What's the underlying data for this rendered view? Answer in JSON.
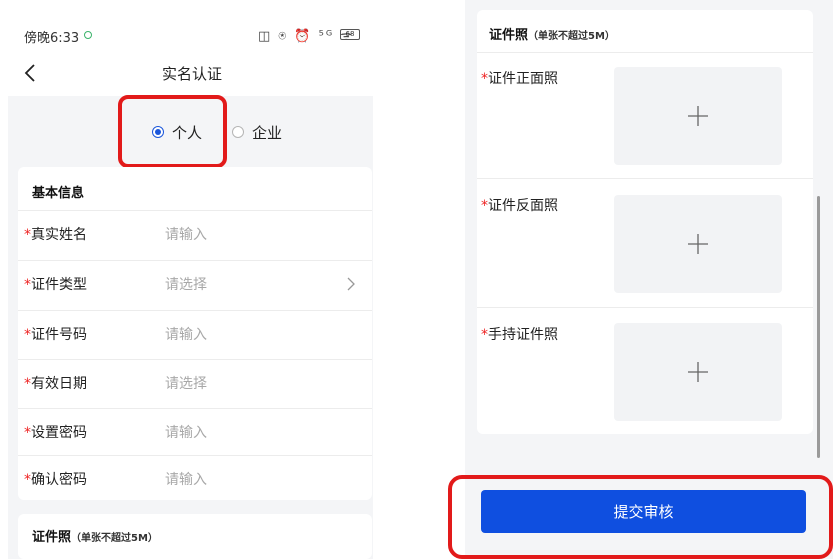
{
  "status_bar": {
    "time": "傍晚6:33",
    "icons_text": "◫ ⍟ ⏰ ⁵ᴳ ᯤ",
    "battery": "68"
  },
  "nav": {
    "title": "实名认证",
    "back_icon": "chevron-left-icon"
  },
  "identity_type": {
    "options": [
      {
        "label": "个人",
        "selected": true
      },
      {
        "label": "企业",
        "selected": false
      }
    ]
  },
  "basic_info": {
    "title": "基本信息",
    "required_mark": "*",
    "fields": [
      {
        "label": "真实姓名",
        "value": "请输入"
      },
      {
        "label": "证件类型",
        "value": "请选择"
      },
      {
        "label": "证件号码",
        "value": "请输入"
      },
      {
        "label": "有效日期",
        "value": "请选择"
      },
      {
        "label": "设置密码",
        "value": "请输入"
      },
      {
        "label": "确认密码",
        "value": "请输入"
      }
    ]
  },
  "certificate": {
    "title": "证件照",
    "note": "（单张不超过5M）",
    "photos": [
      {
        "label": "证件正面照"
      },
      {
        "label": "证件反面照"
      },
      {
        "label": "手持证件照"
      }
    ]
  },
  "submit": {
    "label": "提交审核"
  },
  "colors": {
    "primary": "#0f4fe0",
    "required": "#e22222",
    "highlight": "#e21a1a",
    "placeholder": "#a8a8a8"
  }
}
